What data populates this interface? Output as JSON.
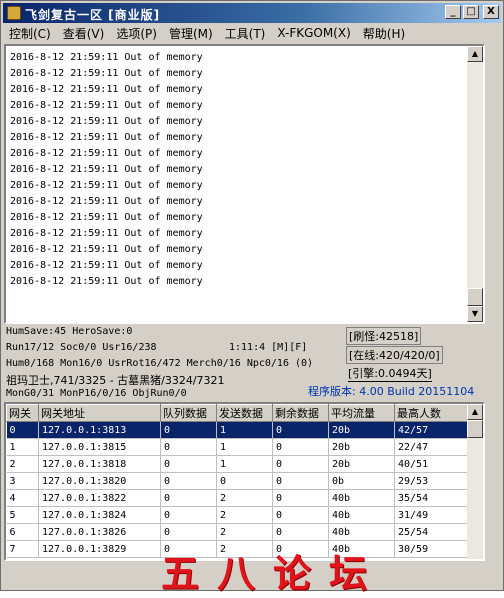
{
  "window": {
    "title": "飞剑复古一区 [商业版]",
    "buttons": [
      "_",
      "□",
      "X"
    ]
  },
  "menu": [
    "控制(C)",
    "查看(V)",
    "选项(P)",
    "管理(M)",
    "工具(T)",
    "X-FKGOM(X)",
    "帮助(H)"
  ],
  "log": {
    "lines": [
      "2016-8-12 21:59:11 Out of memory",
      "2016-8-12 21:59:11 Out of memory",
      "2016-8-12 21:59:11 Out of memory",
      "2016-8-12 21:59:11 Out of memory",
      "2016-8-12 21:59:11 Out of memory",
      "2016-8-12 21:59:11 Out of memory",
      "2016-8-12 21:59:11 Out of memory",
      "2016-8-12 21:59:11 Out of memory",
      "2016-8-12 21:59:11 Out of memory",
      "2016-8-12 21:59:11 Out of memory",
      "2016-8-12 21:59:11 Out of memory",
      "2016-8-12 21:59:11 Out of memory",
      "2016-8-12 21:59:11 Out of memory",
      "2016-8-12 21:59:11 Out of memory",
      "2016-8-12 21:59:11 Out of memory"
    ]
  },
  "status": {
    "line1": "HumSave:45 HeroSave:0",
    "line2": "Run17/12 Soc0/0 Usr16/238",
    "time": "1:11:4 [M][F]",
    "line3": "Hum0/168 Mon16/0 UsrRot16/472 Merch0/16 Npc0/16 (0)",
    "line4": "祖玛卫士,741/3325 - 古墓黑猪/3324/7321",
    "line5": "MonG0/31 MonP16/0/16 ObjRun0/0",
    "refresh_monsters": "[刷怪:42518]",
    "online": "[在线:420/420/0]",
    "engine": "[引擎:0.0494天]",
    "version": "程序版本: 4.00 Build 20151104"
  },
  "grid": {
    "headers": [
      "网关",
      "网关地址",
      "队列数据",
      "发送数据",
      "剩余数据",
      "平均流量",
      "最高人数"
    ],
    "rows": [
      [
        "0",
        "127.0.0.1:3813",
        "0",
        "1",
        "0",
        "20b",
        "42/57"
      ],
      [
        "1",
        "127.0.0.1:3815",
        "0",
        "1",
        "0",
        "20b",
        "22/47"
      ],
      [
        "2",
        "127.0.0.1:3818",
        "0",
        "1",
        "0",
        "20b",
        "40/51"
      ],
      [
        "3",
        "127.0.0.1:3820",
        "0",
        "0",
        "0",
        "0b",
        "29/53"
      ],
      [
        "4",
        "127.0.0.1:3822",
        "0",
        "2",
        "0",
        "40b",
        "35/54"
      ],
      [
        "5",
        "127.0.0.1:3824",
        "0",
        "2",
        "0",
        "40b",
        "31/49"
      ],
      [
        "6",
        "127.0.0.1:3826",
        "0",
        "2",
        "0",
        "40b",
        "25/54"
      ],
      [
        "7",
        "127.0.0.1:3829",
        "0",
        "2",
        "0",
        "40b",
        "30/59"
      ]
    ],
    "selected_row": 0
  },
  "watermark": "五八论坛"
}
